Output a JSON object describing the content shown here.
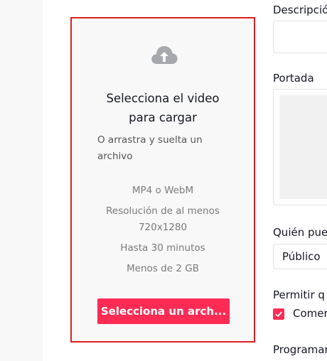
{
  "upload": {
    "icon": "cloud-upload-icon",
    "title_line1": "Selecciona el video",
    "title_line2": "para cargar",
    "subtitle_line1": "O arrastra y suelta un",
    "subtitle_line2": "archivo",
    "formats": "MP4 o WebM",
    "resolution_line1": "Resolución de al menos",
    "resolution_line2": "720x1280",
    "duration": "Hasta 30 minutos",
    "size": "Menos de 2 GB",
    "button_label": "Selecciona un arch..."
  },
  "form": {
    "description_label": "Descripció",
    "cover_label": "Portada",
    "who_label": "Quién pue",
    "who_value": "Público",
    "allow_label": "Permitir q",
    "comments_label": "Comer",
    "comments_checked": true,
    "schedule_label": "Programar"
  },
  "colors": {
    "accent": "#fe2c55",
    "upload_border": "#e01e1e"
  }
}
